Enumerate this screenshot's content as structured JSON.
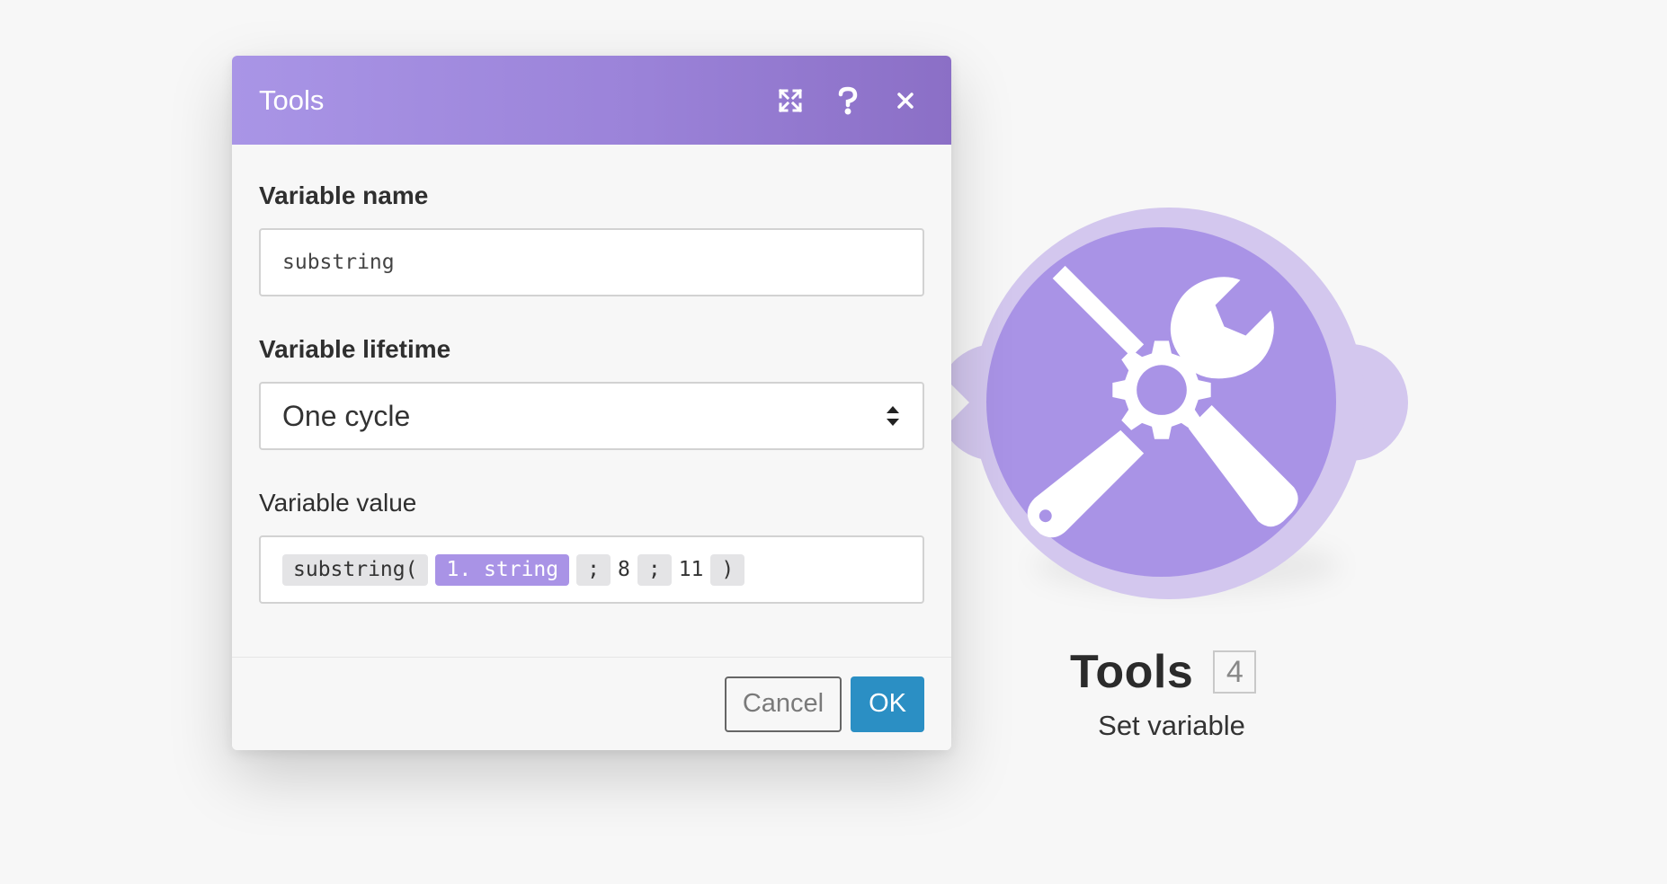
{
  "dialog": {
    "title": "Tools",
    "header_icons": [
      "expand-icon",
      "help-icon",
      "close-icon"
    ],
    "fields": {
      "variable_name": {
        "label": "Variable name",
        "value": "substring"
      },
      "variable_lifetime": {
        "label": "Variable lifetime",
        "selected": "One cycle"
      },
      "variable_value": {
        "label": "Variable value",
        "tokens": [
          {
            "text": "substring(",
            "kind": "function"
          },
          {
            "text": "1. string",
            "kind": "variable"
          },
          {
            "text": ";",
            "kind": "separator"
          },
          {
            "text": "8",
            "kind": "literal"
          },
          {
            "text": ";",
            "kind": "separator"
          },
          {
            "text": "11",
            "kind": "literal"
          },
          {
            "text": ")",
            "kind": "function"
          }
        ]
      }
    },
    "buttons": {
      "cancel": "Cancel",
      "ok": "OK"
    }
  },
  "module": {
    "icon": "tools-icon",
    "title": "Tools",
    "badge": "4",
    "subtitle": "Set variable"
  },
  "colors": {
    "accent_purple": "#a993e6",
    "light_purple": "#d3c7ee",
    "ok_blue": "#2b8fc4",
    "background": "#f7f7f7"
  }
}
